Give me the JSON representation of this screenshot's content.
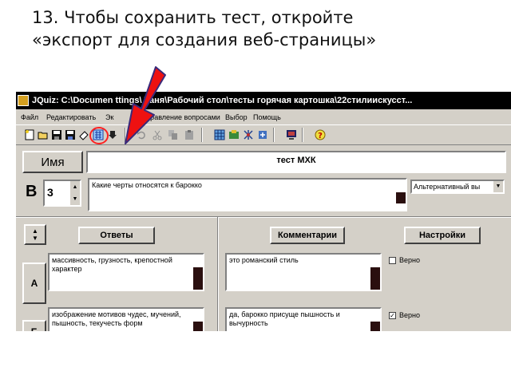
{
  "slide": {
    "title_line1": "13. Чтобы сохранить тест, откройте",
    "title_line2": "«экспорт для создания веб-страницы»"
  },
  "window": {
    "title": "JQuiz: C:\\Documen       ttings\\ Таня\\Рабочий стол\\тесты горячая картошка\\22стилиискусст..."
  },
  "menu": {
    "items": [
      "Файл",
      "Редактировать",
      "Эк",
      "Управление вопросами",
      "Выбор",
      "Помощь"
    ]
  },
  "toolbar": {
    "icons": [
      "new-file-icon",
      "open-folder-icon",
      "save-icon",
      "save-as-icon",
      "eraser-icon",
      "export-web-page-icon",
      "download-icon",
      "undo-icon",
      "cut-icon",
      "copy-icon",
      "paste-icon",
      "grid-icon",
      "book-icon",
      "tree-icon",
      "settings-icon",
      "monitor-icon",
      "help-icon"
    ]
  },
  "form": {
    "name_label": "Имя",
    "test_title": "тест МХК",
    "question_label": "В",
    "question_number": "3",
    "question_text": "Какие черты относятся к барокко",
    "question_type": "Альтернативный вы",
    "answers_button": "Ответы",
    "comments_button": "Комментарии",
    "settings_button": "Настройки",
    "rows": [
      {
        "letter": "А",
        "answer": "массивность, грузность, крепостной характер",
        "comment": "это романский стиль",
        "correct_label": "Верно",
        "checked": false
      },
      {
        "letter": "Б",
        "answer": "изображение мотивов чудес, мучений, пышность, текучесть форм",
        "comment": "да, барокко присуще пышность и вычурность",
        "correct_label": "Верно",
        "checked": true
      }
    ]
  },
  "colors": {
    "window_bg": "#d4d0c8",
    "titlebar_bg": "#000000",
    "arrow_fill": "#ee1111",
    "highlight_circle": "#ff2020"
  }
}
